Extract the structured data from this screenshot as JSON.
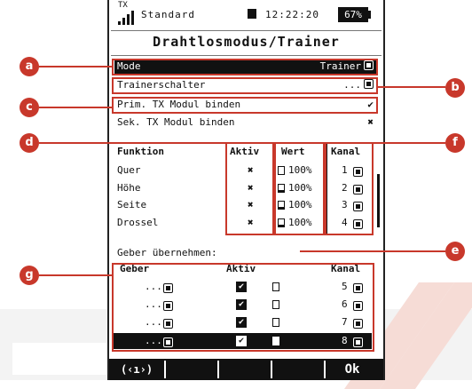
{
  "status": {
    "tx_label": "TX",
    "model_name": "Standard",
    "time": "12:22:20",
    "battery": "67%"
  },
  "title": "Drahtlosmodus/Trainer",
  "menu": {
    "mode_label": "Mode",
    "mode_value": "Trainer",
    "trainer_switch_label": "Trainerschalter",
    "trainer_switch_value": "...",
    "primary_bind_label": "Prim. TX Modul binden",
    "primary_bind_value": "✔",
    "secondary_bind_label": "Sek. TX Modul binden",
    "secondary_bind_value": "✖"
  },
  "function_table": {
    "headers": [
      "Funktion",
      "Aktiv",
      "Wert",
      "Kanal"
    ],
    "rows": [
      {
        "name": "Quer",
        "active": "✖",
        "value": "100%",
        "channel": "1",
        "fill": 0
      },
      {
        "name": "Höhe",
        "active": "✖",
        "value": "100%",
        "channel": "2",
        "fill": 0.2
      },
      {
        "name": "Seite",
        "active": "✖",
        "value": "100%",
        "channel": "3",
        "fill": 0.2
      },
      {
        "name": "Drossel",
        "active": "✖",
        "value": "100%",
        "channel": "4",
        "fill": 0.2
      }
    ]
  },
  "geber": {
    "section_title": "Geber übernehmen:",
    "headers": [
      "Geber",
      "Aktiv",
      "Kanal"
    ],
    "rows": [
      {
        "geber": "...",
        "channel": "5",
        "fill": 0
      },
      {
        "geber": "...",
        "channel": "6",
        "fill": 0
      },
      {
        "geber": "...",
        "channel": "7",
        "fill": 0
      },
      {
        "geber": "...",
        "channel": "8",
        "fill": 1
      }
    ]
  },
  "softkeys": {
    "wireless_icon": "(‹ı›)",
    "ok_label": "Ok"
  },
  "annotations": [
    "a",
    "b",
    "c",
    "d",
    "e",
    "f",
    "g"
  ],
  "colors": {
    "annotation": "#c8382b",
    "screen_bg": "#ffffff",
    "ink": "#111111"
  }
}
